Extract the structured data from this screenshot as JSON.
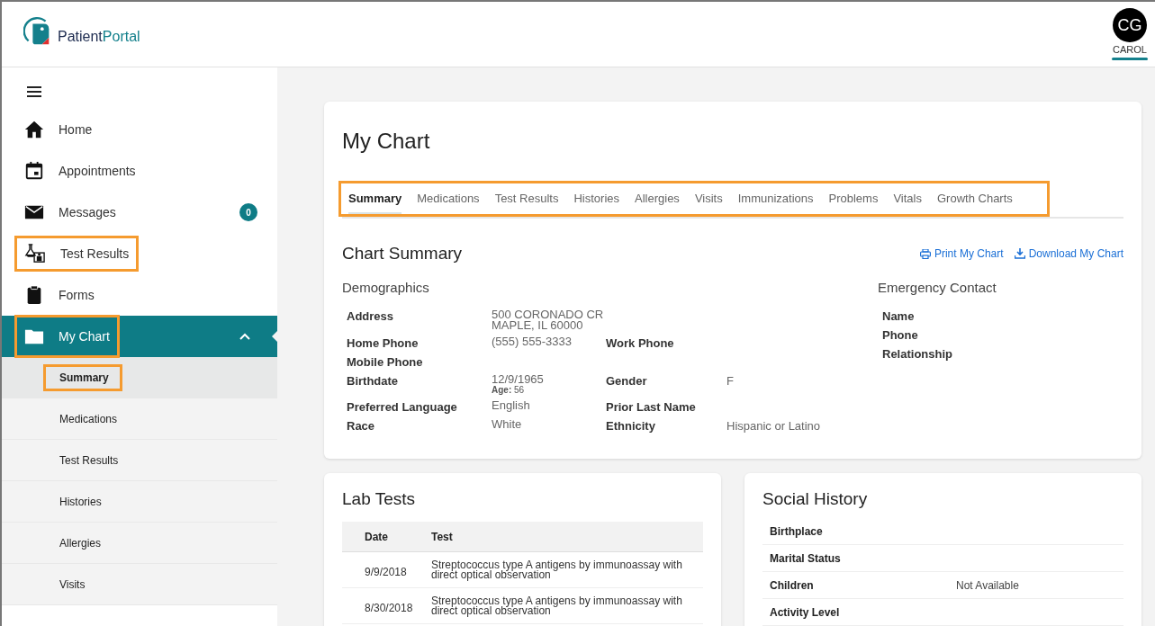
{
  "header": {
    "brand_parts": [
      "Patient",
      "Portal"
    ],
    "user": {
      "initials": "CG",
      "name": "CAROL"
    }
  },
  "sidebar": {
    "items": [
      {
        "label": "Home",
        "selected": false,
        "highlighted": false
      },
      {
        "label": "Appointments",
        "selected": false,
        "highlighted": false
      },
      {
        "label": "Messages",
        "selected": false,
        "highlighted": false,
        "badge": "0"
      },
      {
        "label": "Test Results",
        "selected": false,
        "highlighted": true
      },
      {
        "label": "Forms",
        "selected": false,
        "highlighted": false
      },
      {
        "label": "My Chart",
        "selected": true,
        "highlighted": true,
        "expanded": true,
        "children": [
          {
            "label": "Summary",
            "selected": true,
            "highlighted": true
          },
          {
            "label": "Medications",
            "selected": false,
            "highlighted": false
          },
          {
            "label": "Test Results",
            "selected": false,
            "highlighted": false
          },
          {
            "label": "Histories",
            "selected": false,
            "highlighted": false
          },
          {
            "label": "Allergies",
            "selected": false,
            "highlighted": false
          },
          {
            "label": "Visits",
            "selected": false,
            "highlighted": false
          }
        ]
      }
    ]
  },
  "page": {
    "title": "My Chart",
    "tabs_highlighted": true,
    "tabs": [
      {
        "label": "Summary",
        "selected": true
      },
      {
        "label": "Medications",
        "selected": false
      },
      {
        "label": "Test Results",
        "selected": false
      },
      {
        "label": "Histories",
        "selected": false
      },
      {
        "label": "Allergies",
        "selected": false
      },
      {
        "label": "Visits",
        "selected": false
      },
      {
        "label": "Immunizations",
        "selected": false
      },
      {
        "label": "Problems",
        "selected": false
      },
      {
        "label": "Vitals",
        "selected": false
      },
      {
        "label": "Growth Charts",
        "selected": false
      }
    ]
  },
  "chart_summary": {
    "title": "Chart Summary",
    "links": [
      "Print My Chart",
      "Download My Chart"
    ],
    "demographics": {
      "title": "Demographics",
      "rows": [
        {
          "label": "Address",
          "value_lines": [
            "500 CORONADO CR",
            "MAPLE, IL 60000"
          ]
        },
        {
          "label": "Home Phone",
          "value_lines": [
            "(555) 555-3333"
          ],
          "label_2": "Work Phone"
        },
        {
          "label": "Mobile Phone"
        },
        {
          "label": "Birthdate",
          "value_lines": [
            "12/9/1965"
          ],
          "note": "**Age:** 56",
          "label_2": "Gender",
          "value_2": "F"
        },
        {
          "label": "Preferred Language",
          "value_lines": [
            "English"
          ],
          "label_2": "Prior Last Name"
        },
        {
          "label": "Race",
          "value_lines": [
            "White"
          ],
          "label_2": "Ethnicity",
          "value_2": "Hispanic or Latino"
        }
      ]
    },
    "emergency_contact": {
      "title": "Emergency Contact",
      "labels": [
        "Name",
        "Phone",
        "Relationship"
      ]
    }
  },
  "lab_tests": {
    "title": "Lab Tests",
    "columns": [
      "Date",
      "Test"
    ],
    "rows": [
      [
        "9/9/2018",
        "Streptococcus type A antigens by immunoassay with direct optical observation"
      ],
      [
        "8/30/2018",
        "Streptococcus type A antigens by immunoassay with direct optical observation"
      ]
    ]
  },
  "social_history": {
    "title": "Social History",
    "rows": [
      {
        "label": "Birthplace"
      },
      {
        "label": "Marital Status"
      },
      {
        "label": "Children",
        "value": "Not Available"
      },
      {
        "label": "Activity Level"
      }
    ]
  }
}
